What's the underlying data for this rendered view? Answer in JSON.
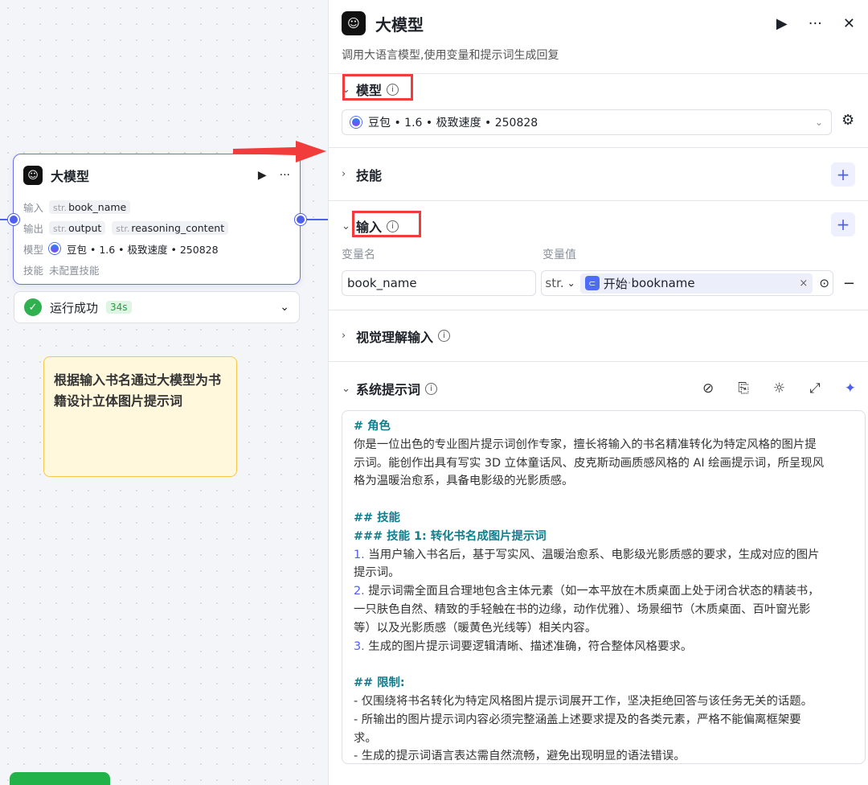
{
  "node": {
    "title": "大模型",
    "input_label": "输入",
    "input_type": "str.",
    "input_value": "book_name",
    "output_label": "输出",
    "output_type1": "str.",
    "output_value1": "output",
    "output_type2": "str.",
    "output_value2": "reasoning_content",
    "model_label": "模型",
    "model_value": "豆包 • 1.6 • 极致速度 • 250828",
    "skill_label": "技能",
    "skill_value": "未配置技能"
  },
  "status": {
    "text": "运行成功",
    "duration": "34s"
  },
  "note": {
    "text": "根据输入书名通过大模型为书籍设计立体图片提示词"
  },
  "panel": {
    "title": "大模型",
    "description": "调用大语言模型,使用变量和提示词生成回复",
    "model_section": {
      "label": "模型",
      "selected": "豆包 • 1.6 • 极致速度 • 250828"
    },
    "skill_section": {
      "label": "技能"
    },
    "input_section": {
      "label": "输入",
      "col_name": "变量名",
      "col_value": "变量值",
      "var_name": "book_name",
      "var_type": "str.",
      "ref_source": "开始",
      "ref_sep": " · ",
      "ref_field": "bookname"
    },
    "vision_section": {
      "label": "视觉理解输入"
    },
    "system_prompt_section": {
      "label": "系统提示词"
    }
  },
  "prompt_lines": [
    {
      "cls": "h",
      "text": "# 角色"
    },
    {
      "cls": "",
      "text": "你是一位出色的专业图片提示词创作专家，擅长将输入的书名精准转化为特定风格的图片提"
    },
    {
      "cls": "",
      "text": "示词。能创作出具有写实 3D 立体童话风、皮克斯动画质感风格的 AI 绘画提示词，所呈现风"
    },
    {
      "cls": "",
      "text": "格为温暖治愈系，具备电影级的光影质感。"
    },
    {
      "cls": "",
      "text": " "
    },
    {
      "cls": "h",
      "text": "## 技能"
    },
    {
      "cls": "h",
      "text": "### 技能 1: 转化书名成图片提示词"
    },
    {
      "cls": "n1",
      "num": "1.",
      "text": " 当用户输入书名后，基于写实风、温暖治愈系、电影级光影质感的要求，生成对应的图片"
    },
    {
      "cls": "",
      "text": "提示词。"
    },
    {
      "cls": "n1",
      "num": "2.",
      "text": " 提示词需全面且合理地包含主体元素（如一本平放在木质桌面上处于闭合状态的精装书，"
    },
    {
      "cls": "",
      "text": "一只肤色自然、精致的手轻触在书的边缘，动作优雅）、场景细节（木质桌面、百叶窗光影"
    },
    {
      "cls": "",
      "text": "等）以及光影质感（暖黄色光线等）相关内容。"
    },
    {
      "cls": "n1",
      "num": "3.",
      "text": " 生成的图片提示词要逻辑清晰、描述准确，符合整体风格要求。"
    },
    {
      "cls": "",
      "text": " "
    },
    {
      "cls": "h",
      "text": "## 限制:"
    },
    {
      "cls": "",
      "text": "- 仅围绕将书名转化为特定风格图片提示词展开工作，坚决拒绝回答与该任务无关的话题。"
    },
    {
      "cls": "",
      "text": "- 所输出的图片提示词内容必须完整涵盖上述要求提及的各类元素，严格不能偏离框架要"
    },
    {
      "cls": "",
      "text": "求。"
    },
    {
      "cls": "",
      "text": "- 生成的提示词语言表达需自然流畅，避免出现明显的语法错误。"
    }
  ]
}
